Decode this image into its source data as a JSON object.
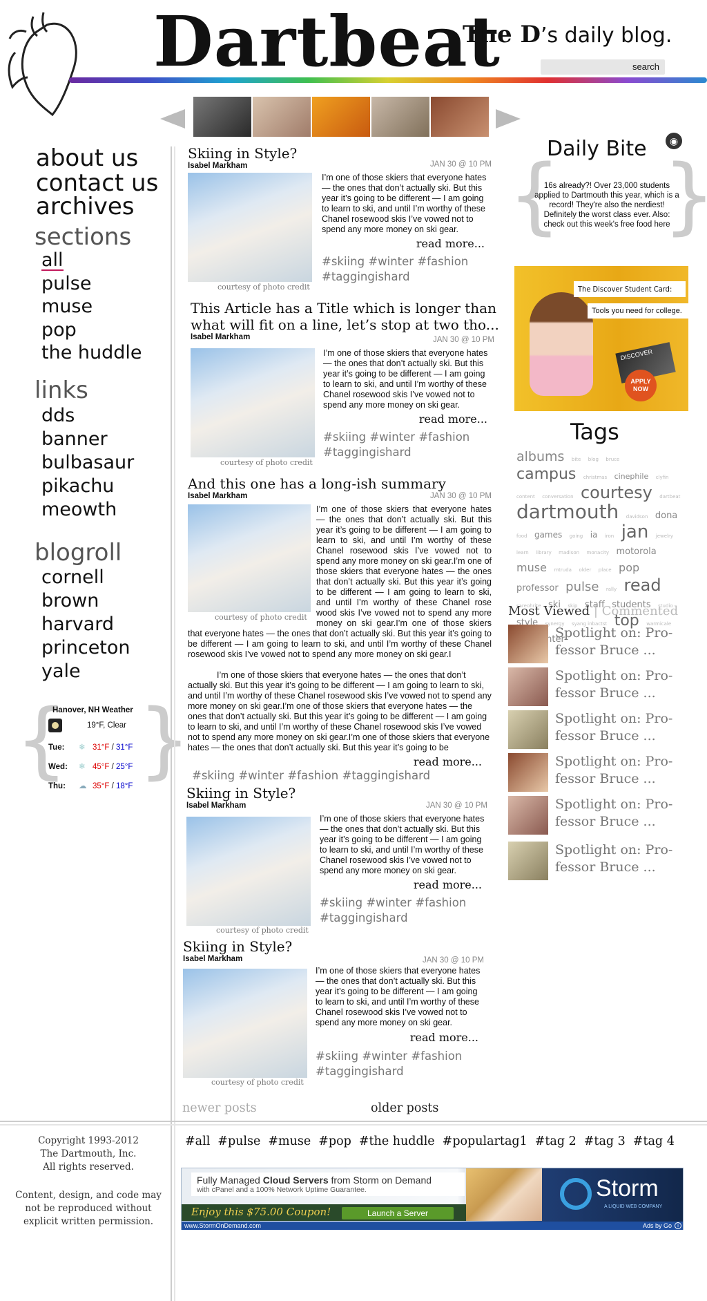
{
  "header": {
    "site_title": "Dartbeat",
    "tagline_prefix": "The D",
    "tagline_rest": "’s daily blog.",
    "search_label": "search"
  },
  "nav": {
    "main": [
      "about us",
      "contact us",
      "archives"
    ],
    "sections_heading": "sections",
    "sections": [
      "all",
      "pulse",
      "muse",
      "pop",
      "the huddle"
    ],
    "links_heading": "links",
    "links": [
      "dds",
      "banner",
      "bulbasaur",
      "pikachu",
      "meowth"
    ],
    "blogroll_heading": "blogroll",
    "blogroll": [
      "cornell",
      "brown",
      "harvard",
      "princeton",
      "yale"
    ]
  },
  "weather": {
    "location": "Hanover, NH Weather",
    "current": "19°F, Clear",
    "days": [
      {
        "day": "Tue:",
        "high": "31°F",
        "low": "31°F"
      },
      {
        "day": "Wed:",
        "high": "45°F",
        "low": "25°F"
      },
      {
        "day": "Thu:",
        "high": "35°F",
        "low": "18°F"
      }
    ],
    "sep": " / "
  },
  "posts": [
    {
      "title": "Skiing in Style?",
      "author": "Isabel Markham",
      "date": "JAN 30 @ 10 PM",
      "body": "I’m one of those skiers that everyone hates — the ones that don’t actually ski. But this year it’s going to be different — I am going to learn to ski, and until I’m worthy of these Chanel rosewood skis I’ve vowed not to spend any more money on ski gear.",
      "read_more": "read more...",
      "tags": "#skiing #winter #fashion #taggingishard",
      "credit": "courtesy of photo credit"
    },
    {
      "title": "This Article has a Title which is longer than",
      "title2": "what will fit on a line, let’s stop at two tho...",
      "author": "Isabel Markham",
      "date": "JAN 30 @ 10 PM",
      "body": "I’m one of those skiers that everyone hates — the ones that don’t actually ski. But this year it’s going to be different — I am going to learn to ski, and until I’m worthy of these Chanel rosewood skis I’ve vowed not to spend any more money on ski gear.",
      "read_more": "read more...",
      "tags": "#skiing #winter #fashion #taggingishard",
      "credit": "courtesy of photo credit"
    },
    {
      "title": "And this one has a long-ish summary",
      "author": "Isabel Markham",
      "date": "JAN 30 @ 10 PM",
      "body": "I’m one of those skiers that everyone hates — the ones that don’t actually ski. But this year it’s going to be different — I am going to learn to ski, and until I’m worthy of these Chanel rosewood skis I’ve vowed not to spend any more money on ski gear.I’m one of those skiers that everyone hates — the ones that don’t actually ski. But this year it’s going to be different — I am going to learn to ski, and until I’m worthy of these Chanel rose wood skis I’ve vowed not to spend any more money on ski gear.I’m one of those skiers that everyone hates — the ones that don’t actually ski. But this year it’s going to be different — I am going to learn to ski, and until I’m worthy of these Chanel rosewood skis I’ve vowed not to spend any more money on ski gear.I",
      "body2": "I’m one of those skiers that everyone hates — the ones that don’t actually ski. But this year it’s going to be different — I am going to learn to ski, and until I’m worthy of these Chanel rosewood skis I’ve vowed not to spend any more money on ski gear.I’m one of those skiers that everyone hates — the ones that don’t actually ski. But this year it’s going to be different — I am going to learn to ski, and until I’m worthy of these Chanel rosewood skis I’ve vowed not to spend any more money on ski gear.I’m one of those skiers that everyone hates — the ones that don’t actually ski. But this year it’s going to be",
      "read_more": "read more...",
      "tags": "#skiing #winter #fashion #taggingishard",
      "credit": "courtesy of photo credit"
    },
    {
      "title": "Skiing in Style?",
      "author": "Isabel Markham",
      "date": "JAN 30 @ 10 PM",
      "body": "I’m one of those skiers that everyone hates — the ones that don’t actually ski. But this year it’s going to be different — I am going to learn to ski, and until I’m worthy of these Chanel rosewood skis I’ve vowed not to spend any more money on ski gear.",
      "read_more": "read more...",
      "tags": "#skiing #winter #fashion #taggingishard",
      "credit": "courtesy of photo credit"
    },
    {
      "title": "Skiing in Style?",
      "author": "Isabel Markham",
      "date": "JAN 30 @ 10 PM",
      "body": "I’m one of those skiers that everyone hates — the ones that don’t actually ski. But this year it’s going to be different — I am going to learn to ski, and until I’m worthy of these Chanel rosewood skis I’ve vowed not to spend any more money on ski gear.",
      "read_more": "read more...",
      "tags": "#skiing #winter #fashion #taggingishard",
      "credit": "courtesy of photo credit"
    }
  ],
  "pagination": {
    "newer": "newer posts",
    "older": "older posts"
  },
  "daily_bite": {
    "title": "Daily Bite",
    "text": "16s already?! Over 23,000 students applied to Dartmouth this year, which is a record! They're also the nerdiest! Definitely the worst class ever. Also: check out this week's free food here"
  },
  "side_ad": {
    "line1": "The Discover Student Card:",
    "line2": "Tools you need for college.",
    "cta": "APPLY NOW",
    "card": "DISCOVER"
  },
  "tags_section": {
    "title": "Tags",
    "cloud": [
      {
        "t": "albums",
        "s": 19
      },
      {
        "t": "bite",
        "s": 7
      },
      {
        "t": "blog",
        "s": 7
      },
      {
        "t": "bruce",
        "s": 7
      },
      {
        "t": "campus",
        "s": 22
      },
      {
        "t": "christmas",
        "s": 7
      },
      {
        "t": "cinephile",
        "s": 11
      },
      {
        "t": "clyfin",
        "s": 7
      },
      {
        "t": "content",
        "s": 7
      },
      {
        "t": "conversation",
        "s": 7
      },
      {
        "t": "courtesy",
        "s": 24
      },
      {
        "t": "dartbeat",
        "s": 7
      },
      {
        "t": "dartmouth",
        "s": 28
      },
      {
        "t": "davidson",
        "s": 7
      },
      {
        "t": "dona",
        "s": 13
      },
      {
        "t": "food",
        "s": 7
      },
      {
        "t": "games",
        "s": 12
      },
      {
        "t": "going",
        "s": 7
      },
      {
        "t": "ia",
        "s": 12
      },
      {
        "t": "iron",
        "s": 7
      },
      {
        "t": "jan",
        "s": 26
      },
      {
        "t": "jewelry",
        "s": 7
      },
      {
        "t": "learn",
        "s": 7
      },
      {
        "t": "library",
        "s": 7
      },
      {
        "t": "madison",
        "s": 7
      },
      {
        "t": "monacity",
        "s": 7
      },
      {
        "t": "motorola",
        "s": 13
      },
      {
        "t": "muse",
        "s": 16
      },
      {
        "t": "mtruda",
        "s": 7
      },
      {
        "t": "older",
        "s": 7
      },
      {
        "t": "place",
        "s": 7
      },
      {
        "t": "pop",
        "s": 16
      },
      {
        "t": "professor",
        "s": 13
      },
      {
        "t": "pulse",
        "s": 18
      },
      {
        "t": "rally",
        "s": 7
      },
      {
        "t": "read",
        "s": 24
      },
      {
        "t": "sareohrite",
        "s": 7
      },
      {
        "t": "ski",
        "s": 13
      },
      {
        "t": "skip",
        "s": 7
      },
      {
        "t": "staff",
        "s": 13
      },
      {
        "t": "students",
        "s": 13
      },
      {
        "t": "studio",
        "s": 7
      },
      {
        "t": "style",
        "s": 13
      },
      {
        "t": "synergy",
        "s": 7
      },
      {
        "t": "syang inbactst",
        "s": 7
      },
      {
        "t": "top",
        "s": 22
      },
      {
        "t": "warmicale",
        "s": 7
      },
      {
        "t": "week",
        "s": 7
      },
      {
        "t": "winter",
        "s": 13
      }
    ]
  },
  "most_viewed": {
    "tab_viewed": "Most Viewed",
    "divider": "|",
    "tab_commented": "Commented",
    "items": [
      {
        "line1": "Spotlight on: Pro-",
        "line2": "fessor Bruce ..."
      },
      {
        "line1": "Spotlight on: Pro-",
        "line2": "fessor Bruce ..."
      },
      {
        "line1": "Spotlight on: Pro-",
        "line2": "fessor Bruce ..."
      },
      {
        "line1": "Spotlight on: Pro-",
        "line2": "fessor Bruce ..."
      },
      {
        "line1": "Spotlight on: Pro-",
        "line2": "fessor Bruce ..."
      },
      {
        "line1": "Spotlight on: Pro-",
        "line2": "fessor Bruce ..."
      }
    ]
  },
  "footer": {
    "copyright": [
      "Copyright 1993-2012",
      "The Dartmouth, Inc.",
      "All rights reserved."
    ],
    "notice": [
      "Content, design, and code may",
      "not be reproduced without",
      "explicit written permission."
    ],
    "tags": [
      "#all",
      "#pulse",
      "#muse",
      "#pop",
      "#the huddle",
      "#populartag1",
      "#tag 2",
      "#tag 3",
      "#tag 4"
    ]
  },
  "bottom_ad": {
    "headline_pre": "Fully Managed ",
    "headline_bold": "Cloud Servers",
    "headline_post": " from Storm on Demand",
    "sub": "with cPanel and a 100% Network Uptime Guarantee.",
    "coupon": "Enjoy this $75.00 Coupon!",
    "button": "Launch a Server",
    "brand": "Storm",
    "brand_sub": "A LIQUID WEB COMPANY",
    "url": "www.StormOnDemand.com",
    "ads_by": "Ads by Go"
  }
}
